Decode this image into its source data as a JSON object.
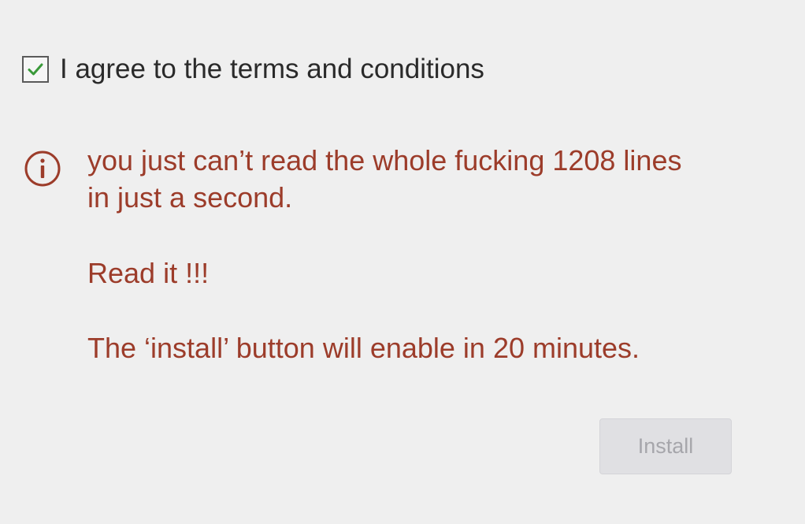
{
  "consent": {
    "checked": true,
    "label": "I agree to the terms and conditions",
    "check_color": "#3a9a3a"
  },
  "warning": {
    "icon": "info-icon",
    "color": "#9c3c2a",
    "line_1": "you just can’t read the whole fucking 1208 lines",
    "line_2": "in just a second.",
    "line_3": "Read it !!!",
    "line_4": "The ‘install’ button will enable in 20 minutes."
  },
  "install_button": {
    "label": "Install",
    "enabled": false
  }
}
